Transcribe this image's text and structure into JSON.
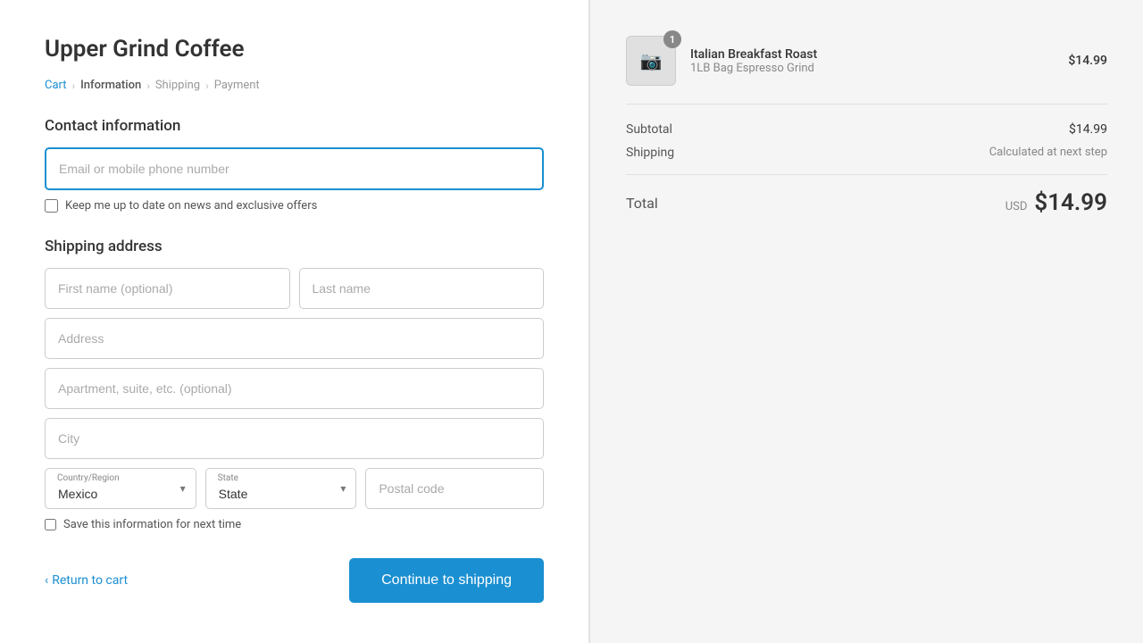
{
  "store": {
    "name": "Upper Grind Coffee"
  },
  "breadcrumb": {
    "cart": "Cart",
    "information": "Information",
    "shipping": "Shipping",
    "payment": "Payment"
  },
  "contact": {
    "section_title": "Contact information",
    "email_placeholder": "Email or mobile phone number",
    "newsletter_label": "Keep me up to date on news and exclusive offers"
  },
  "shipping": {
    "section_title": "Shipping address",
    "first_name_placeholder": "First name (optional)",
    "last_name_placeholder": "Last name",
    "address_placeholder": "Address",
    "apartment_placeholder": "Apartment, suite, etc. (optional)",
    "city_placeholder": "City",
    "country_label": "Country/Region",
    "country_value": "Mexico",
    "state_label": "State",
    "state_value": "State",
    "postal_placeholder": "Postal code",
    "save_label": "Save this information for next time"
  },
  "footer": {
    "return_label": "Return to cart",
    "continue_label": "Continue to shipping"
  },
  "order": {
    "item": {
      "name": "Italian Breakfast Roast",
      "description": "1LB Bag Espresso Grind",
      "price": "$14.99",
      "quantity": "1"
    },
    "subtotal_label": "Subtotal",
    "subtotal_value": "$14.99",
    "shipping_label": "Shipping",
    "shipping_value": "Calculated at next step",
    "total_label": "Total",
    "total_currency": "USD",
    "total_value": "$14.99"
  }
}
